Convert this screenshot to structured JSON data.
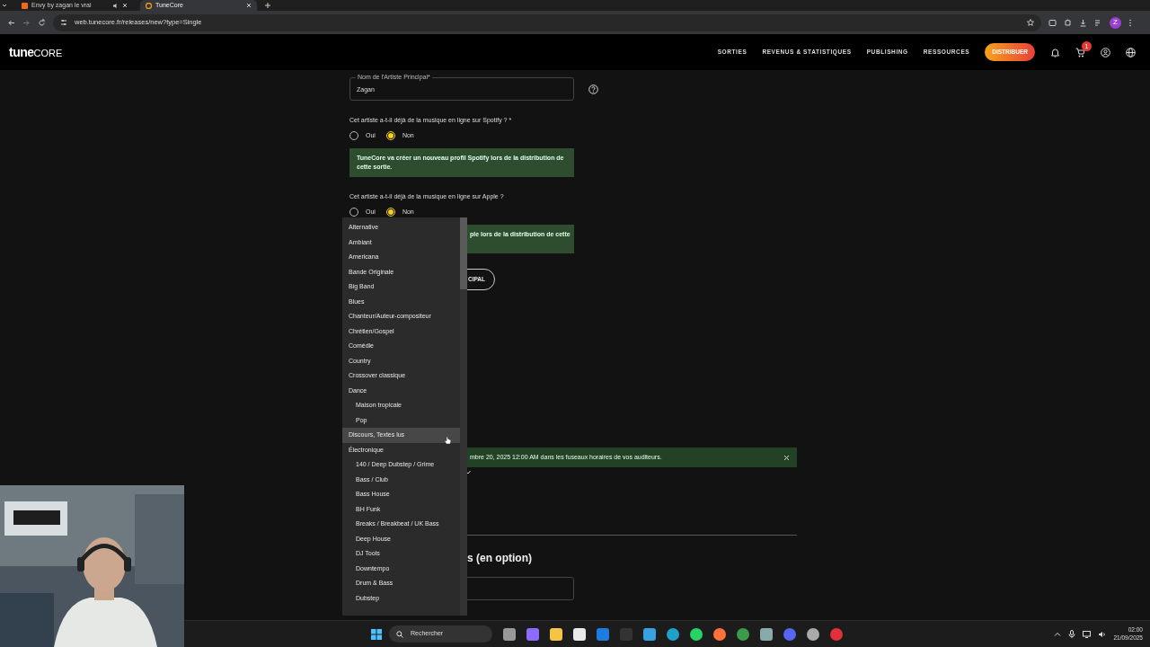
{
  "browser": {
    "tabs": [
      {
        "title": "Envy by zagan le vrai",
        "selected": false,
        "audio": true
      },
      {
        "title": "TuneCore",
        "selected": true,
        "audio": false
      }
    ],
    "url": "web.tunecore.fr/releases/new?type=Single",
    "profile": "Z"
  },
  "header": {
    "logo_bold": "tune",
    "logo_light": "CORE",
    "nav": [
      "SORTIES",
      "REVENUS & STATISTIQUES",
      "PUBLISHING",
      "RESSOURCES"
    ],
    "cta": "DISTRIBUER",
    "cart_count": "1"
  },
  "form": {
    "artist_field": {
      "label": "Nom de l'Artiste Principal*",
      "value": "Zagan"
    },
    "questions": [
      {
        "text": "Cet artiste a-t-il déjà de la musique en ligne sur Spotify ? *",
        "options": [
          {
            "label": "Oui",
            "selected": false
          },
          {
            "label": "Non",
            "selected": true
          }
        ],
        "notice": "TuneCore va créer un nouveau profil Spotify lors de la distribution de cette sortie."
      },
      {
        "text": "Cet artiste a-t-il déjà de la musique en ligne sur Apple ?",
        "options": [
          {
            "label": "Oui",
            "selected": false
          },
          {
            "label": "Non",
            "selected": true
          }
        ],
        "notice": "ple lors de la distribution de cette"
      }
    ],
    "add_button": "CIPAL",
    "banner": "mbre 20, 2025 12:00 AM dans les fuseaux horaires de vos auditeurs.",
    "section_heading": "s (en option)"
  },
  "genre_list": {
    "items": [
      {
        "label": "Alternative",
        "highlighted": false
      },
      {
        "label": "Ambiant",
        "highlighted": false
      },
      {
        "label": "Americana",
        "highlighted": false
      },
      {
        "label": "Bande Originale",
        "highlighted": false
      },
      {
        "label": "Big Band",
        "highlighted": false
      },
      {
        "label": "Blues",
        "highlighted": false
      },
      {
        "label": "Chanteur/Auteur-compositeur",
        "highlighted": false
      },
      {
        "label": "Chrétien/Gospel",
        "highlighted": false
      },
      {
        "label": "Comédie",
        "highlighted": false
      },
      {
        "label": "Country",
        "highlighted": false
      },
      {
        "label": "Crossover classique",
        "highlighted": false
      },
      {
        "label": "Dance",
        "highlighted": false,
        "children": [
          {
            "label": "Maison tropicale",
            "highlighted": false
          },
          {
            "label": "Pop",
            "highlighted": false
          }
        ]
      },
      {
        "label": "Discours, Textes lus",
        "highlighted": true
      },
      {
        "label": "Électronique",
        "highlighted": false,
        "children": [
          {
            "label": "140 / Deep Dubstep / Grime",
            "highlighted": false
          },
          {
            "label": "Bass / Club",
            "highlighted": false
          },
          {
            "label": "Bass House",
            "highlighted": false
          },
          {
            "label": "BH Funk",
            "highlighted": false
          },
          {
            "label": "Breaks / Breakbeat / UK Bass",
            "highlighted": false
          },
          {
            "label": "Deep House",
            "highlighted": false
          },
          {
            "label": "DJ Tools",
            "highlighted": false
          },
          {
            "label": "Downtempo",
            "highlighted": false
          },
          {
            "label": "Drum & Bass",
            "highlighted": false
          },
          {
            "label": "Dubstep",
            "highlighted": false
          }
        ]
      }
    ]
  },
  "taskbar": {
    "search": "Rechercher",
    "time": "02:00",
    "date": "21/09/2025"
  }
}
